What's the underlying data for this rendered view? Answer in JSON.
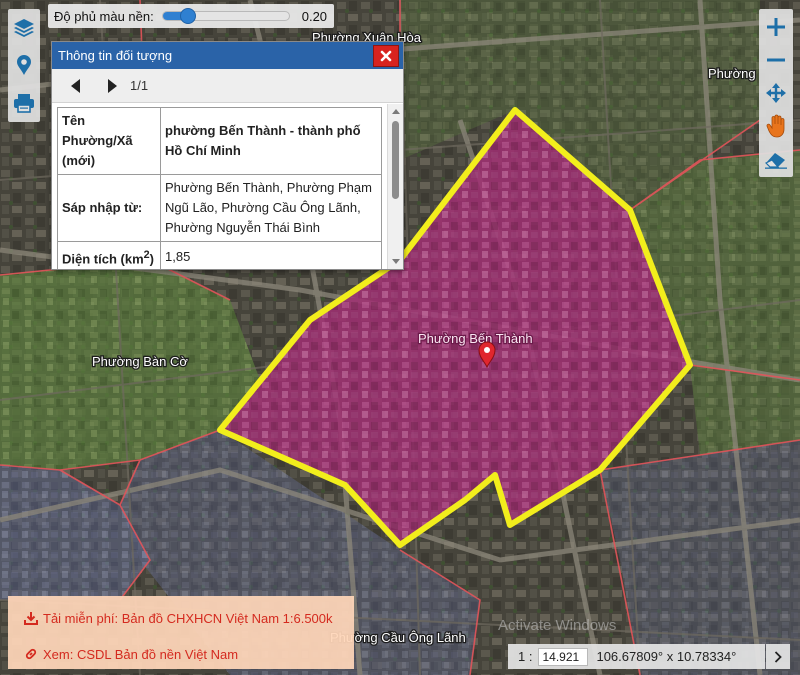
{
  "opacity_control": {
    "label": "Độ phủ màu nền:",
    "value_text": "0.20",
    "value": 0.2
  },
  "left_toolbar": [
    {
      "name": "layers-icon"
    },
    {
      "name": "location-pin-icon"
    },
    {
      "name": "print-icon"
    }
  ],
  "right_toolbar": [
    {
      "name": "zoom-in-icon"
    },
    {
      "name": "zoom-out-icon"
    },
    {
      "name": "pan-arrows-icon"
    },
    {
      "name": "hand-icon"
    },
    {
      "name": "eraser-icon"
    }
  ],
  "info_panel": {
    "title": "Thông tin đối tượng",
    "page": "1/1",
    "rows": [
      {
        "key": "Tên Phường/Xã (mới)",
        "value": "phường Bến Thành - thành phố Hồ Chí Minh"
      },
      {
        "key": "Sáp nhập từ:",
        "value": "Phường Bến Thành, Phường Phạm Ngũ Lão, Phường Cầu Ông Lãnh, Phường Nguyễn Thái Bình"
      },
      {
        "key_prefix": "Diện tích (km",
        "key_sup": "2",
        "key_suffix": ")",
        "value": "1,85"
      }
    ]
  },
  "map": {
    "labels": {
      "xuan_hoa": "Phường Xuân Hòa",
      "ben_thanh": "Phường Bến Thành",
      "ban_co": "Phường Bàn Cờ",
      "cau_ong_lanh": "Phường Cầu Ông Lãnh",
      "right_edge": "Phường"
    },
    "highlight_fill": "#b0307f",
    "highlight_border": "#f2ee1c",
    "boundary_color": "#e2545a",
    "watermark": "Activate Windows"
  },
  "download": {
    "free_label": "Tải miễn phí: Bản đồ CHXHCN Việt Nam 1:6.500k",
    "view_label": "Xem: CSDL Bản đồ nền Việt Nam"
  },
  "scale": {
    "prefix": "1 :",
    "value": "14.921",
    "coords": "106.67809° x 10.78334°"
  }
}
